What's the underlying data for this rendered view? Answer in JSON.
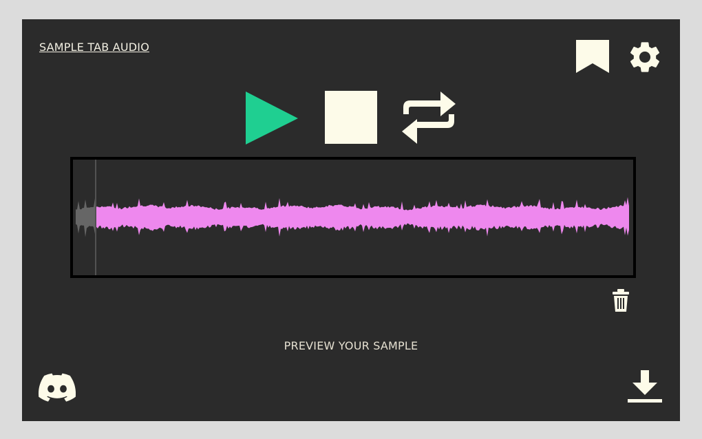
{
  "header": {
    "title_link": "SAMPLE TAB AUDIO"
  },
  "icons": {
    "bookmark": "bookmark-icon",
    "settings": "gear-icon",
    "play": "play-icon",
    "stop": "stop-icon",
    "loop": "loop-icon",
    "trash": "trash-icon",
    "discord": "discord-icon",
    "download": "download-icon"
  },
  "colors": {
    "background": "#2b2b2b",
    "accent_play": "#1fcf91",
    "icon_cream": "#fdfbe9",
    "waveform": "#ee88ee",
    "waveform_inactive": "#666666"
  },
  "waveform": {
    "playhead_position": 0.04
  },
  "footer": {
    "preview_label": "PREVIEW YOUR SAMPLE"
  }
}
